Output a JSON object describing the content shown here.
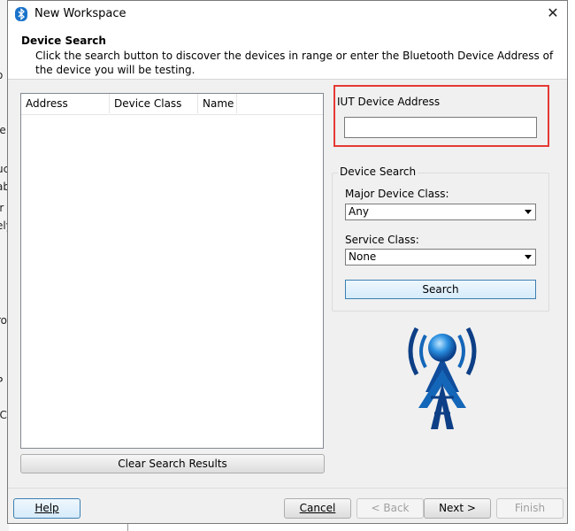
{
  "window": {
    "title": "New Workspace",
    "close_glyph": "✕"
  },
  "background_fragments": [
    "o",
    "ie",
    "uc",
    "ab",
    "ir",
    "ely",
    "ro",
    "P",
    "IC"
  ],
  "header": {
    "title": "Device Search",
    "description": "Click the search button to discover the devices in range or enter the Bluetooth Device Address of the device you will be testing."
  },
  "devices_table": {
    "columns": [
      "Address",
      "Device Class",
      "Name"
    ],
    "rows": []
  },
  "clear_button": "Clear Search Results",
  "iut": {
    "label": "IUT Device Address",
    "value": ""
  },
  "device_search": {
    "group_label": "Device Search",
    "major_label": "Major Device Class:",
    "major_value": "Any",
    "service_label": "Service Class:",
    "service_value": "None",
    "search_button": "Search"
  },
  "footer": {
    "help": "Help",
    "cancel": "Cancel",
    "back": "< Back",
    "next": "Next >",
    "finish": "Finish"
  },
  "colors": {
    "highlight_box": "#e53935",
    "bluetooth_blue": "#1a73c9"
  },
  "icons": [
    "bluetooth-icon",
    "close-icon",
    "wireless-tower-logo"
  ]
}
